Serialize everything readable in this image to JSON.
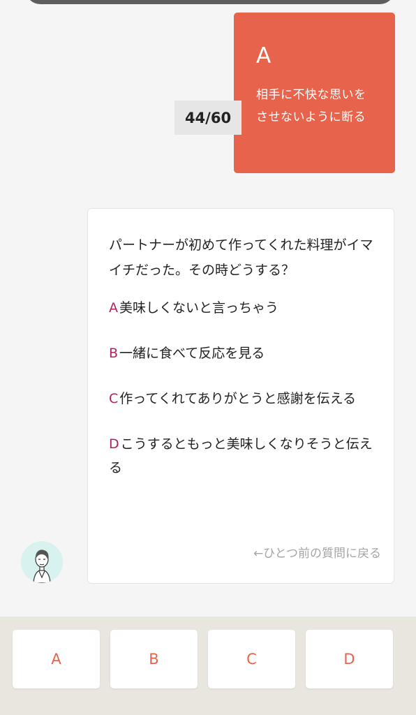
{
  "progress": {
    "label": "44/60"
  },
  "selected_answer": {
    "letter": "A",
    "text": "相手に不快な思いをさせないように断る"
  },
  "question": {
    "text": "パートナーが初めて作ってくれた料理がイマイチだった。その時どうする？",
    "options": [
      {
        "letter": "A",
        "text": "美味しくないと言っちゃう"
      },
      {
        "letter": "B",
        "text": "一緒に食べて反応を見る"
      },
      {
        "letter": "C",
        "text": "作ってくれてありがとうと感謝を伝える"
      },
      {
        "letter": "D",
        "text": "こうするともっと美味しくなりそうと伝える"
      }
    ],
    "back_link": "←ひとつ前の質問に戻る"
  },
  "choices": [
    "A",
    "B",
    "C",
    "D"
  ],
  "icons": {
    "avatar": "person-illustration-icon"
  },
  "colors": {
    "accent": "#e8634b",
    "option_letter": "#b0225f",
    "bottom_bar": "#e9e6e0"
  }
}
